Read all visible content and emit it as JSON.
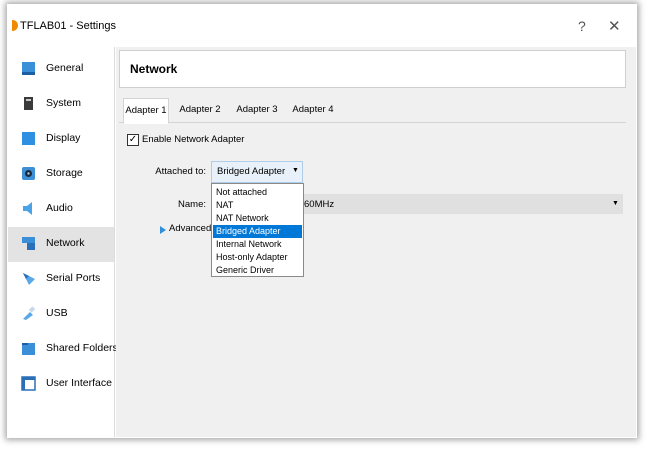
{
  "window": {
    "title": "TFLAB01 - Settings",
    "help": "?",
    "close": "✕"
  },
  "sidebar": {
    "items": [
      {
        "label": "General",
        "icon": "general-icon",
        "selected": false
      },
      {
        "label": "System",
        "icon": "system-icon",
        "selected": false
      },
      {
        "label": "Display",
        "icon": "display-icon",
        "selected": false
      },
      {
        "label": "Storage",
        "icon": "storage-icon",
        "selected": false
      },
      {
        "label": "Audio",
        "icon": "audio-icon",
        "selected": false
      },
      {
        "label": "Network",
        "icon": "network-icon",
        "selected": true
      },
      {
        "label": "Serial Ports",
        "icon": "serial-ports-icon",
        "selected": false
      },
      {
        "label": "USB",
        "icon": "usb-icon",
        "selected": false
      },
      {
        "label": "Shared Folders",
        "icon": "shared-folders-icon",
        "selected": false
      },
      {
        "label": "User Interface",
        "icon": "user-interface-icon",
        "selected": false
      }
    ]
  },
  "main": {
    "header": "Network",
    "tabs": [
      "Adapter 1",
      "Adapter 2",
      "Adapter 3",
      "Adapter 4"
    ],
    "active_tab": "Adapter 1",
    "enable_label": "Enable Network Adapter",
    "enable_checked": "✓",
    "attached_label": "Attached to:",
    "attached_value": "Bridged Adapter",
    "name_label": "Name:",
    "name_value": "60MHz",
    "advanced_label": "Advanced",
    "dropdown_options": [
      "Not attached",
      "NAT",
      "NAT Network",
      "Bridged Adapter",
      "Internal Network",
      "Host-only Adapter",
      "Generic Driver"
    ],
    "dropdown_selected": "Bridged Adapter"
  },
  "colors": {
    "accent": "#0078d7",
    "selected_sidebar": "#e3e3e3",
    "panel_bg": "#f0f0f0"
  }
}
